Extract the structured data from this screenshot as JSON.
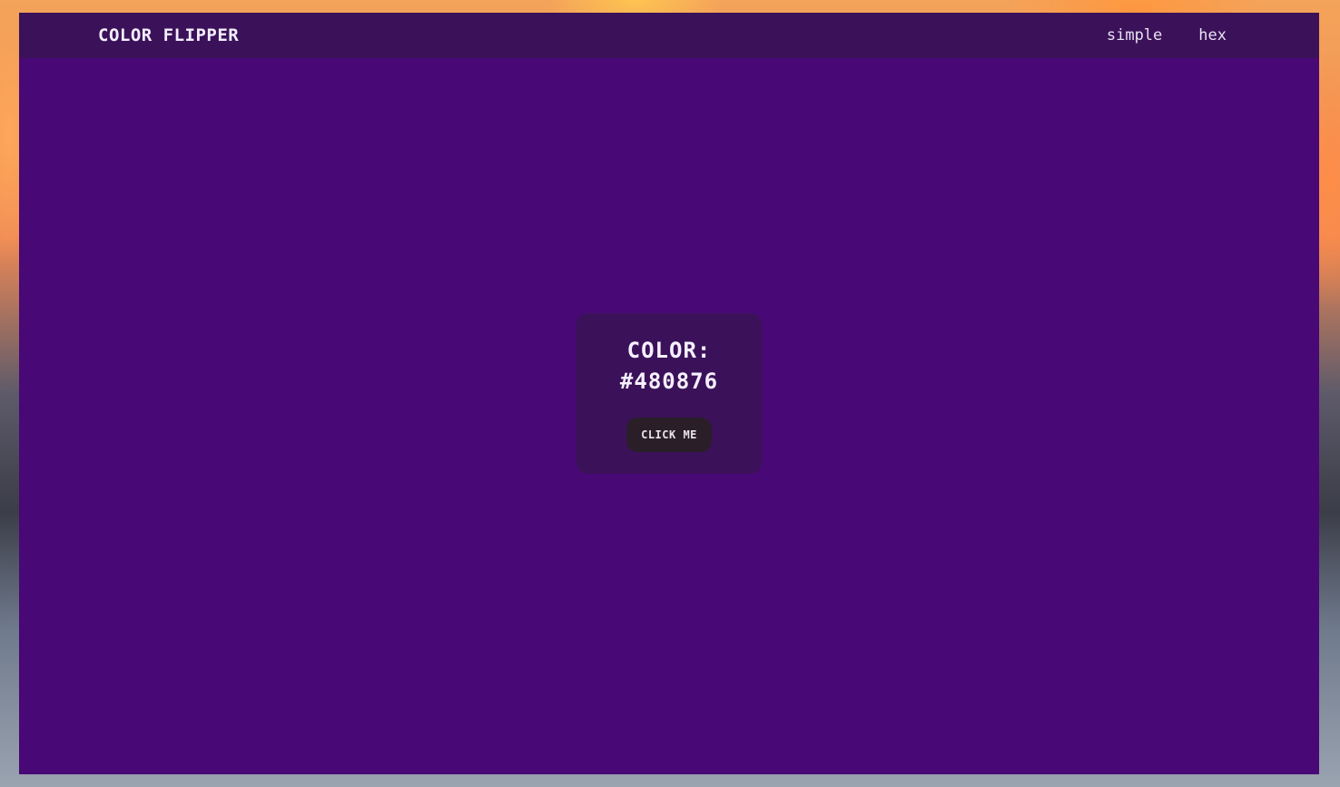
{
  "navbar": {
    "brand": "COLOR FLIPPER",
    "links": [
      {
        "label": "simple"
      },
      {
        "label": "hex"
      }
    ]
  },
  "main": {
    "color_label": "COLOR:",
    "color_value": "#480876",
    "button_label": "CLICK ME"
  },
  "colors": {
    "background": "#480876",
    "navbar": "#3b1259",
    "card": "#3b1259",
    "button": "#2a1f29",
    "text": "#f6f0ff"
  }
}
